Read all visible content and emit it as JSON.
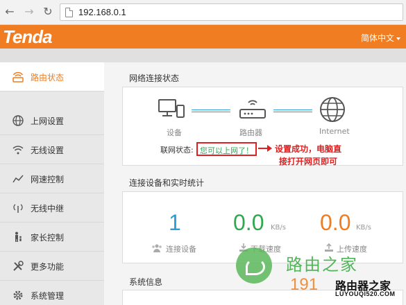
{
  "browser": {
    "url": "192.168.0.1"
  },
  "header": {
    "logo": "Tenda",
    "language": "简体中文",
    "brand_color": "#f07d22"
  },
  "sidebar": {
    "items": [
      {
        "label": "路由状态",
        "icon": "router-status-icon",
        "active": true
      },
      {
        "label": "上网设置",
        "icon": "globe-icon",
        "active": false
      },
      {
        "label": "无线设置",
        "icon": "wifi-icon",
        "active": false
      },
      {
        "label": "网速控制",
        "icon": "speed-chart-icon",
        "active": false
      },
      {
        "label": "无线中继",
        "icon": "repeater-icon",
        "active": false
      },
      {
        "label": "家长控制",
        "icon": "parent-icon",
        "active": false
      },
      {
        "label": "更多功能",
        "icon": "tools-icon",
        "active": false
      },
      {
        "label": "系统管理",
        "icon": "gear-icon",
        "active": false
      }
    ]
  },
  "network": {
    "title": "网络连接状态",
    "device_label": "设备",
    "router_label": "路由器",
    "internet_label": "Internet",
    "status_prefix": "联网状态:",
    "status_text": "您可以上网了！",
    "annotation_line1": "设置成功，电脑直",
    "annotation_line2": "接打开网页即可"
  },
  "stats": {
    "title": "连接设备和实时统计",
    "devices": {
      "value": "1",
      "label": "连接设备",
      "color": "#2a9fd6"
    },
    "download": {
      "value": "0.0",
      "unit": "KB/s",
      "label": "下载速度",
      "color": "#2fa84f"
    },
    "upload": {
      "value": "0.0",
      "unit": "KB/s",
      "label": "上传速度",
      "color": "#f07d22"
    }
  },
  "system": {
    "title": "系统信息"
  },
  "watermark": {
    "text": "路由之家",
    "number": "191",
    "logo_text": "路由器之家",
    "site": "LUYOUQI520.COM"
  }
}
